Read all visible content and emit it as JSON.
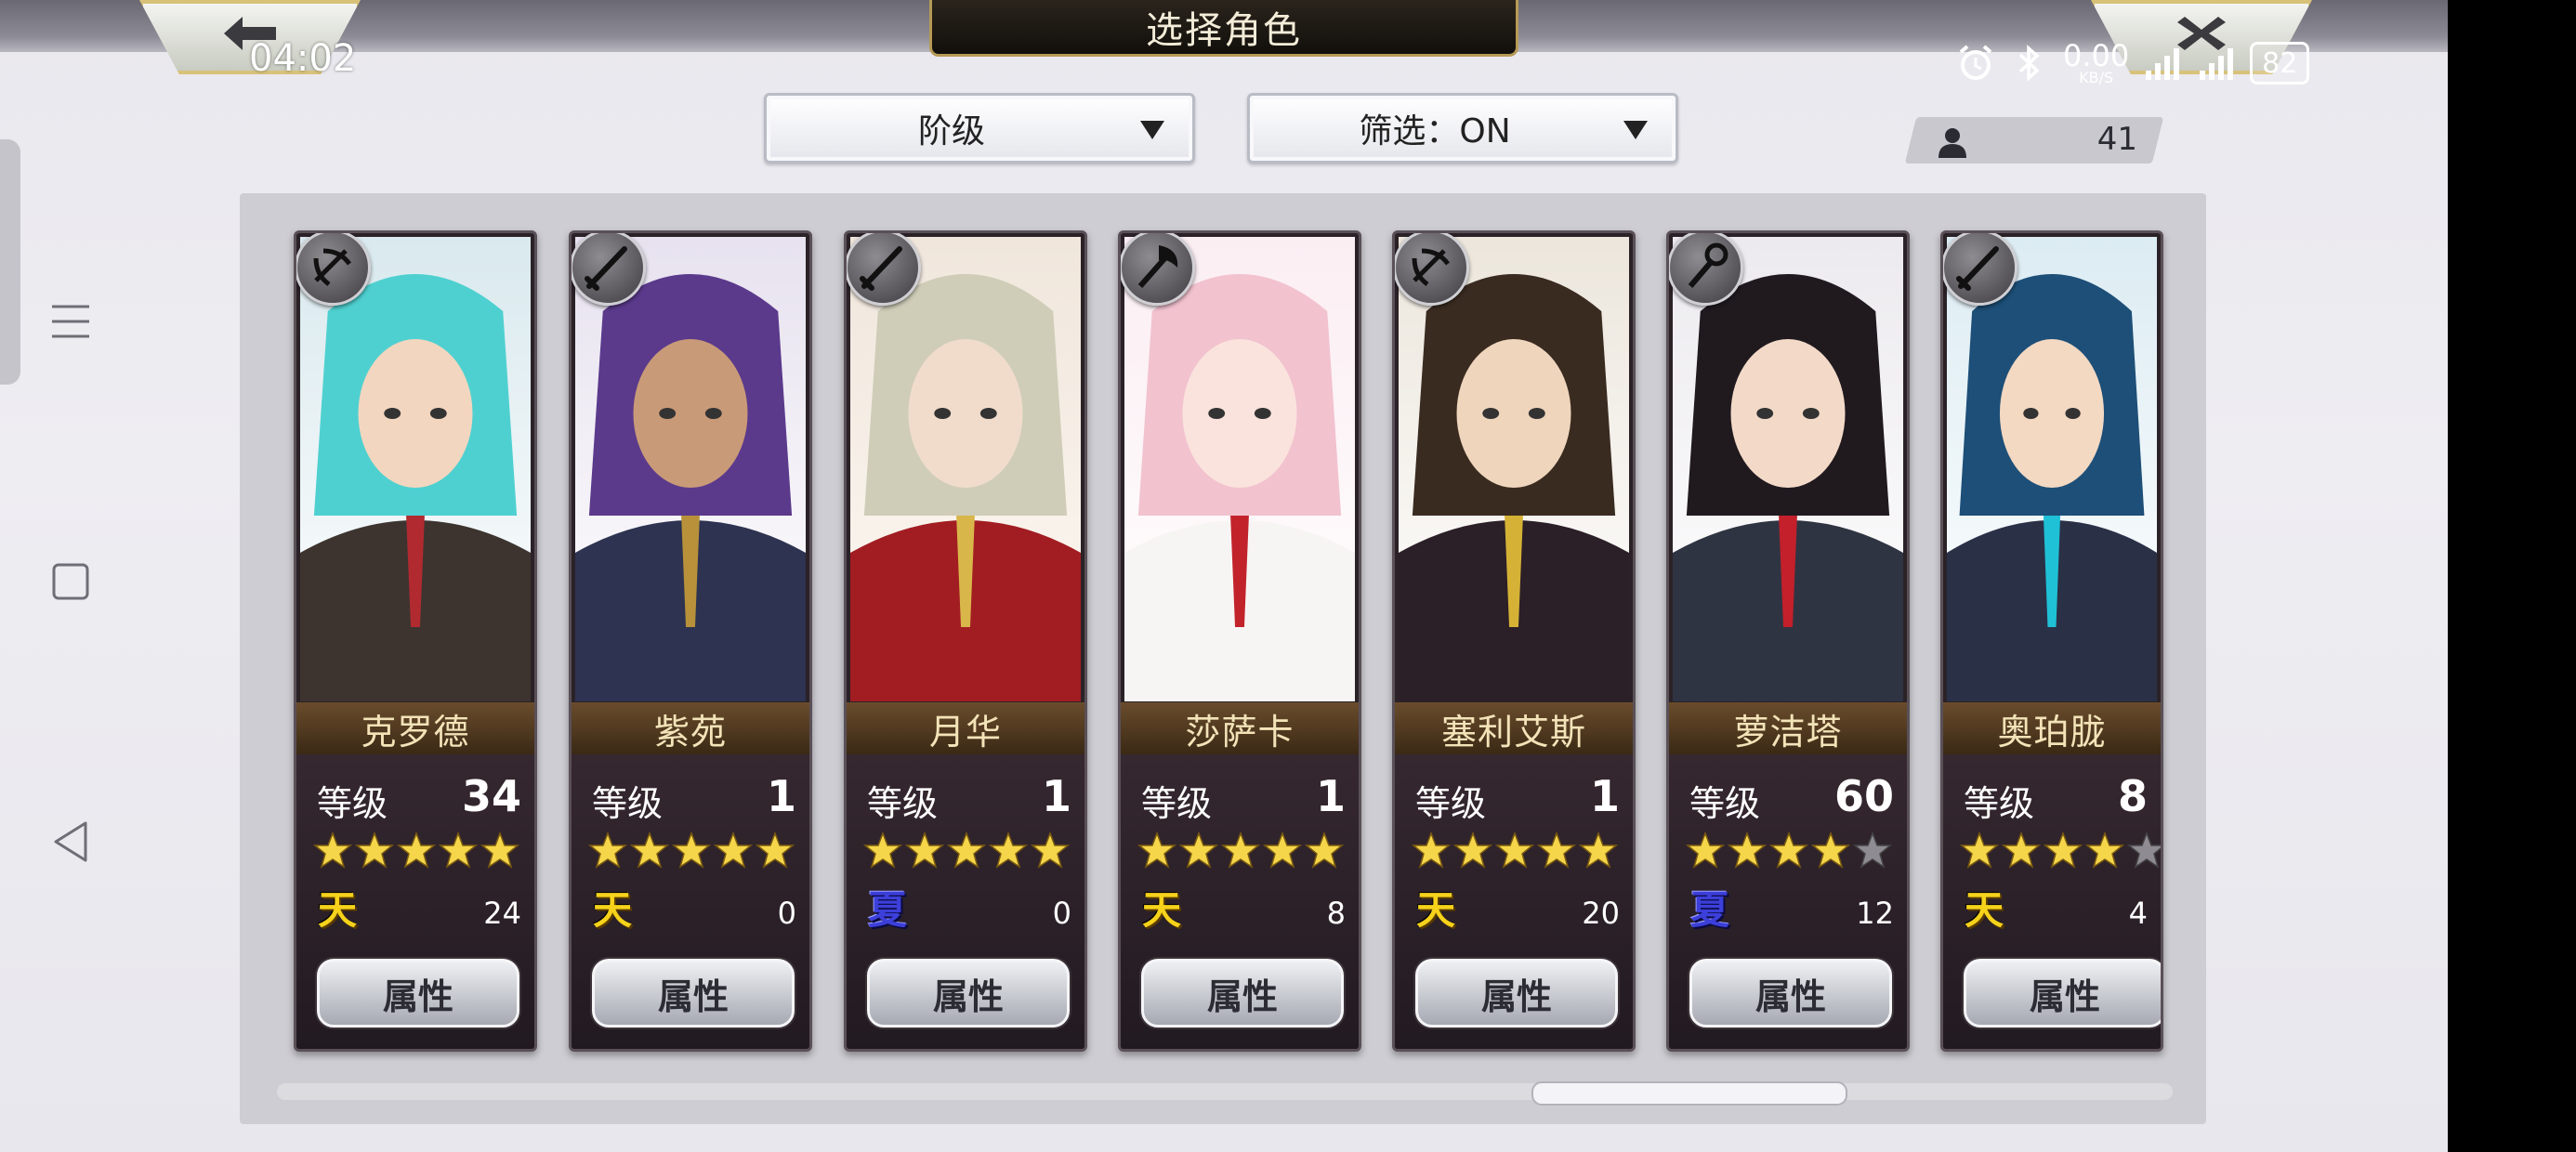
{
  "status_bar": {
    "time": "04:02",
    "net_speed": "0.00",
    "net_unit": "KB/S",
    "battery": "82"
  },
  "header": {
    "title": "选择角色"
  },
  "filters": {
    "rank_dropdown": "阶级",
    "filter_dropdown": "筛选：ON"
  },
  "member_count": "41",
  "colors": {
    "gold_star": "#f5d64a",
    "empty_star": "#8e8b92",
    "name_bar": "#5a3f22"
  },
  "characters": [
    {
      "name": "克罗德",
      "level_label": "等级",
      "level": "34",
      "stars": 5,
      "element": "天",
      "element_icon": "tian",
      "aux": "24",
      "button": "属性",
      "weapon_icon": "crossbow-icon"
    },
    {
      "name": "紫苑",
      "level_label": "等级",
      "level": "1",
      "stars": 5,
      "element": "天",
      "element_icon": "tian",
      "aux": "0",
      "button": "属性",
      "weapon_icon": "katana-icon"
    },
    {
      "name": "月华",
      "level_label": "等级",
      "level": "1",
      "stars": 5,
      "element": "夏",
      "element_icon": "xia",
      "aux": "0",
      "button": "属性",
      "weapon_icon": "katana-icon"
    },
    {
      "name": "莎萨卡",
      "level_label": "等级",
      "level": "1",
      "stars": 5,
      "element": "天",
      "element_icon": "tian",
      "aux": "8",
      "button": "属性",
      "weapon_icon": "axe-icon"
    },
    {
      "name": "塞利艾斯",
      "level_label": "等级",
      "level": "1",
      "stars": 5,
      "element": "天",
      "element_icon": "tian",
      "aux": "20",
      "button": "属性",
      "weapon_icon": "crossbow-icon"
    },
    {
      "name": "萝洁塔",
      "level_label": "等级",
      "level": "60",
      "stars": 4,
      "element": "夏",
      "element_icon": "xia",
      "aux": "12",
      "button": "属性",
      "weapon_icon": "staff-icon"
    },
    {
      "name": "奥珀胧",
      "level_label": "等级",
      "level": "8",
      "stars": 4,
      "element": "天",
      "element_icon": "tian",
      "aux": "4",
      "button": "属性",
      "weapon_icon": "katana-icon"
    }
  ]
}
